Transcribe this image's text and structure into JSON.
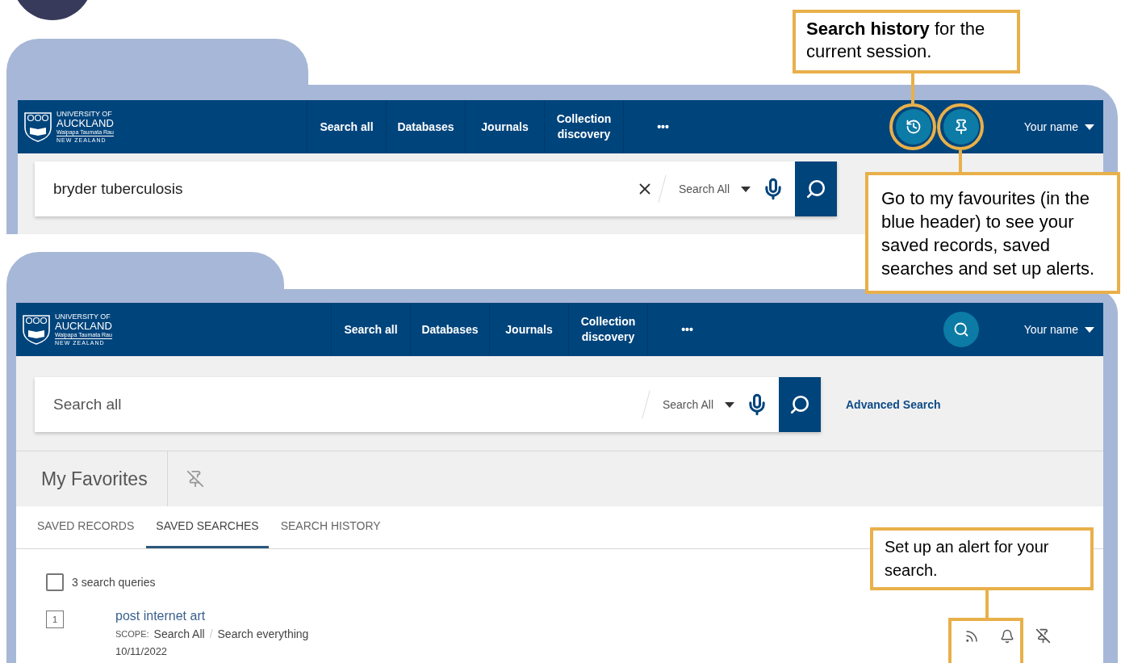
{
  "panels": [
    {
      "header": {
        "logo": [
          "UNIVERSITY OF",
          "AUCKLAND",
          "Waipapa Taumata Rau",
          "NEW ZEALAND"
        ],
        "nav": [
          "Search all",
          "Databases",
          "Journals",
          "Collection discovery",
          "•••"
        ],
        "icon_buttons": [
          {
            "kind": "history"
          },
          {
            "kind": "pin"
          }
        ],
        "user": "Your name"
      },
      "search": {
        "value": "bryder tuberculosis",
        "scope": "Search All"
      }
    },
    {
      "header": {
        "logo": [
          "UNIVERSITY OF",
          "AUCKLAND",
          "Waipapa Taumata Rau",
          "NEW ZEALAND"
        ],
        "nav": [
          "Search all",
          "Databases",
          "Journals",
          "Collection discovery",
          "•••"
        ],
        "icon_buttons": [
          {
            "kind": "search"
          }
        ],
        "user": "Your name"
      },
      "search": {
        "placeholder": "Search all",
        "scope": "Search All"
      },
      "advanced_search": "Advanced Search",
      "favorites": {
        "title": "My Favorites",
        "tabs": [
          {
            "label": "SAVED RECORDS",
            "selected": false
          },
          {
            "label": "SAVED SEARCHES",
            "selected": true
          },
          {
            "label": "SEARCH HISTORY",
            "selected": false
          }
        ],
        "select_all": {
          "label": "3 search queries",
          "checked": false
        },
        "items": [
          {
            "index": "1",
            "title": "post internet art",
            "scope_label": "SCOPE:",
            "scope": "Search All",
            "separator": "/",
            "scope_detail": "Search everything",
            "date": "10/11/2022"
          }
        ]
      }
    }
  ],
  "callouts": [
    {
      "text": "**Search history** for the current session."
    },
    {
      "text": "Go to my favourites (in the blue header) to see your saved records, saved searches and set up alerts."
    },
    {
      "text": "Set up an alert for your search."
    }
  ]
}
